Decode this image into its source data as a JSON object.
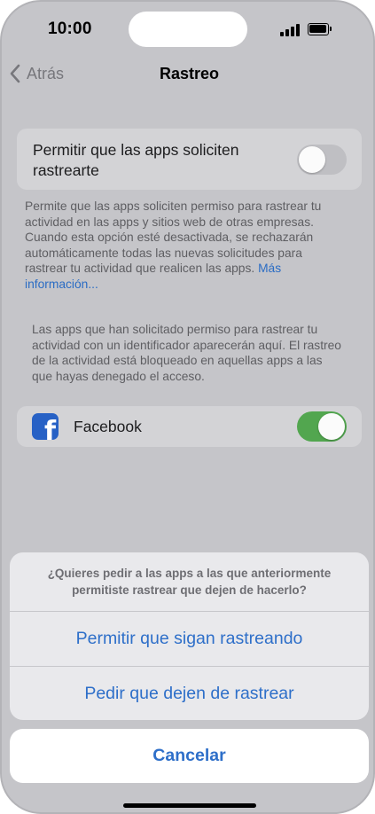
{
  "status_bar": {
    "time": "10:00"
  },
  "nav": {
    "back_label": "Atrás",
    "title": "Rastreo"
  },
  "tracking": {
    "allow_label": "Permitir que las apps soliciten rastrearte",
    "allow_enabled": false,
    "description": "Permite que las apps soliciten permiso para rastrear tu actividad en las apps y sitios web de otras empresas. Cuando esta opción esté desactivada, se rechazarán automáticamente todas las nuevas solicitudes para rastrear tu actividad que realicen las apps.",
    "more_info_link": "Más información...",
    "apps_note": "Las apps que han solicitado permiso para rastrear tu actividad con un identificador aparecerán aquí. El rastreo de la actividad está bloqueado en aquellas apps a las que hayas denegado el acceso."
  },
  "apps": [
    {
      "name": "Facebook",
      "icon": "facebook-icon",
      "enabled": true
    }
  ],
  "action_sheet": {
    "message": "¿Quieres pedir a las apps a las que anteriormente permitiste rastrear que dejen de hacerlo?",
    "allow_button": "Permitir que sigan rastreando",
    "ask_stop_button": "Pedir que dejen de rastrear",
    "cancel_button": "Cancelar"
  },
  "colors": {
    "accent": "#2e6fc9",
    "toggle_on": "#52a64f",
    "facebook_brand": "#2761c5"
  }
}
